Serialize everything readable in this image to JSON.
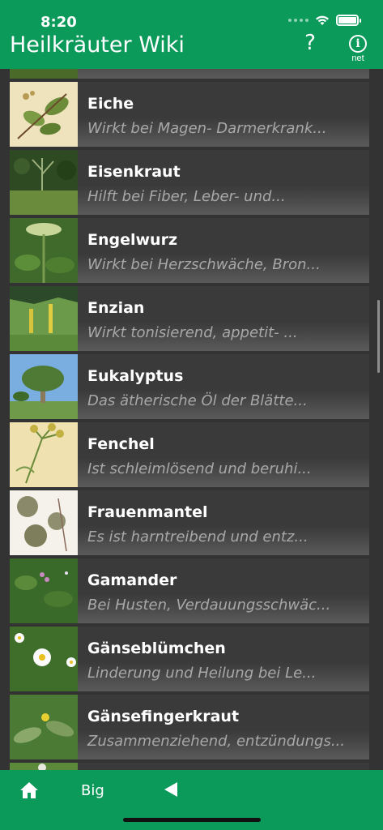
{
  "status_bar": {
    "time": "8:20"
  },
  "header": {
    "title": "Heilkräuter Wiki",
    "help_label": "?",
    "info_symbol": "i",
    "info_label": "net"
  },
  "list": {
    "items": [
      {
        "name": "Eiche",
        "description": "Wirkt bei Magen- Darmerkrank..."
      },
      {
        "name": "Eisenkraut",
        "description": "Hilft bei Fiber, Leber- und..."
      },
      {
        "name": "Engelwurz",
        "description": "Wirkt bei Herzschwäche, Bron..."
      },
      {
        "name": "Enzian",
        "description": "Wirkt tonisierend, appetit- ..."
      },
      {
        "name": "Eukalyptus",
        "description": "Das ätherische Öl der Blätte..."
      },
      {
        "name": "Fenchel",
        "description": "Ist schleimlösend und beruhi..."
      },
      {
        "name": "Frauenmantel",
        "description": "Es ist harntreibend und entz..."
      },
      {
        "name": "Gamander",
        "description": "Bei Husten, Verdauungsschwäc..."
      },
      {
        "name": "Gänseblümchen",
        "description": "Linderung und Heilung bei Le..."
      },
      {
        "name": "Gänsefingerkraut",
        "description": "Zusammenziehend, entzündungs..."
      }
    ]
  },
  "tab_bar": {
    "big_label": "Big",
    "home_icon": "home-icon",
    "back_icon": "back-triangle-icon"
  },
  "colors": {
    "accent": "#0c9a5b",
    "list_background": "#333333",
    "description_text": "#a8a8a8"
  }
}
